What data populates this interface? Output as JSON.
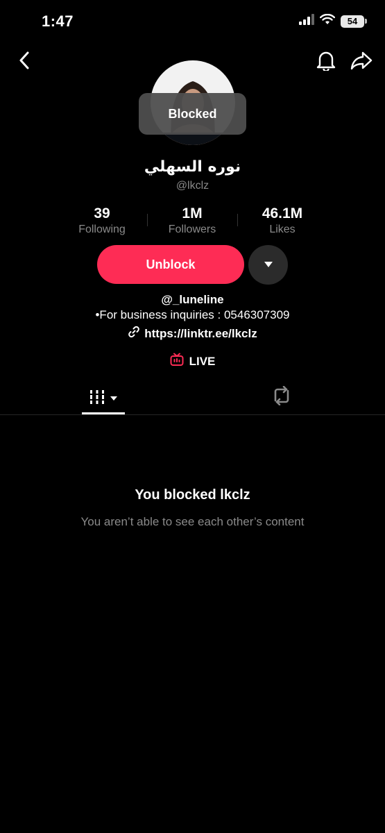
{
  "status_bar": {
    "time": "1:47",
    "battery": "54"
  },
  "toast": {
    "text": "Blocked"
  },
  "profile": {
    "display_name": "نوره السهلي",
    "username": "@lkclz"
  },
  "stats": [
    {
      "value": "39",
      "label": "Following"
    },
    {
      "value": "1M",
      "label": "Followers"
    },
    {
      "value": "46.1M",
      "label": "Likes"
    }
  ],
  "actions": {
    "unblock_label": "Unblock"
  },
  "bio": {
    "line1": "@_luneline",
    "line2": "•For business inquiries : 0546307309",
    "link": "https://linktr.ee/lkclz"
  },
  "live": {
    "label": "LIVE"
  },
  "empty_state": {
    "title": "You blocked lkclz",
    "subtitle": "You aren’t able to see each other’s content"
  },
  "colors": {
    "accent": "#fe2c55",
    "background": "#000000",
    "muted_text": "#8a8a8a"
  },
  "icons": [
    "back-icon",
    "bell-icon",
    "share-icon",
    "chevron-down-icon",
    "link-icon",
    "live-icon",
    "grid-icon",
    "repost-icon",
    "wifi-icon",
    "signal-icon",
    "battery-icon"
  ]
}
